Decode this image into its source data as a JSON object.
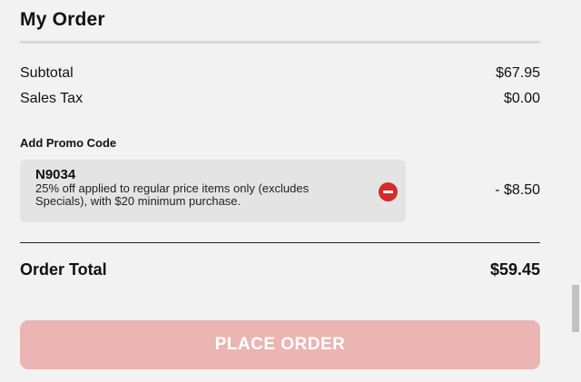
{
  "order": {
    "title": "My Order",
    "subtotal_label": "Subtotal",
    "subtotal_value": "$67.95",
    "tax_label": "Sales Tax",
    "tax_value": "$0.00"
  },
  "promo": {
    "heading": "Add Promo Code",
    "code": "N9034",
    "description": "25% off applied to regular price items only (excludes Specials), with $20 minimum purchase.",
    "discount": "- $8.50",
    "remove_icon": "minus-circle-icon"
  },
  "total": {
    "label": "Order Total",
    "value": "$59.45"
  },
  "actions": {
    "place_order_label": "PLACE ORDER"
  },
  "colors": {
    "accent": "#d62b2b",
    "button_disabled": "#ebb5b3",
    "background": "#f2f2f2"
  }
}
